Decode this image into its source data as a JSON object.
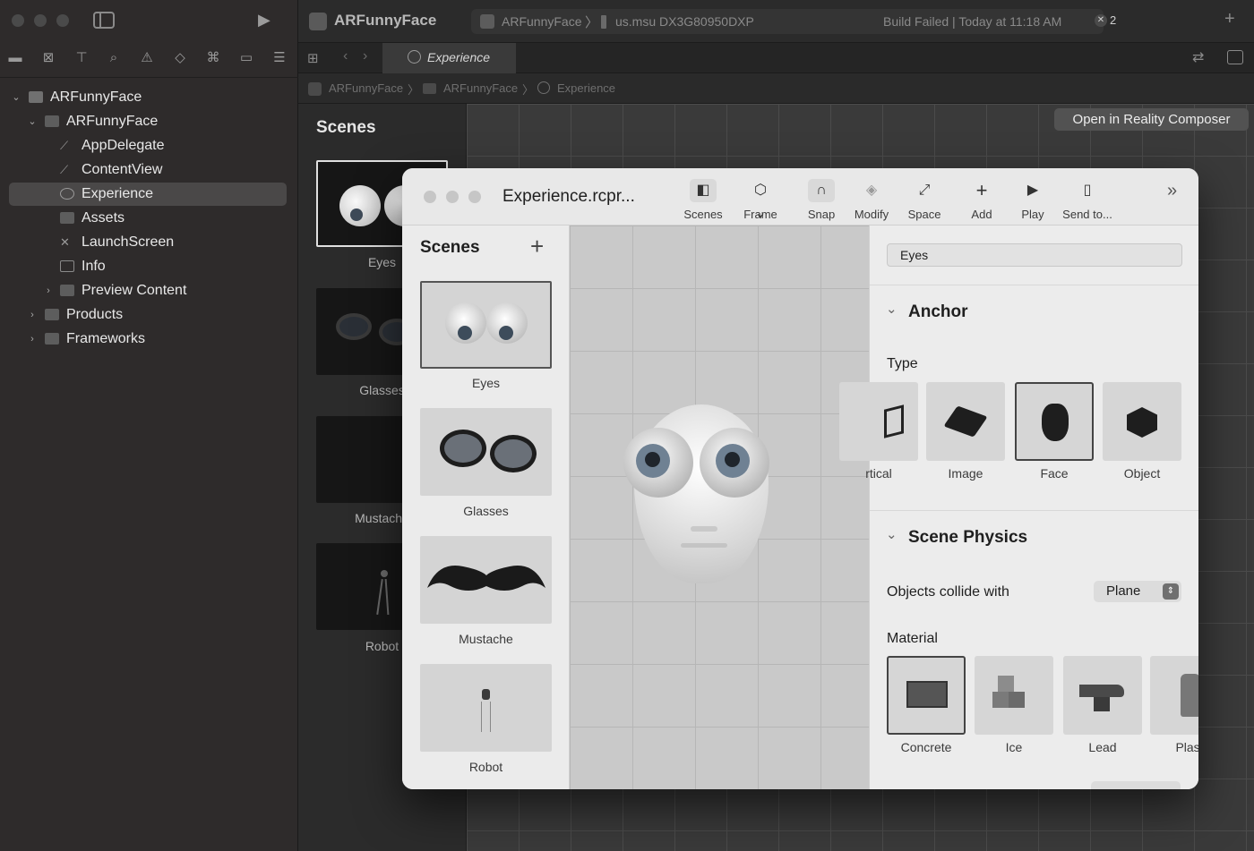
{
  "xcode": {
    "sidebar": {
      "tree": [
        {
          "label": "ARFunnyFace",
          "icon": "project-icon",
          "level": 0,
          "expanded": true
        },
        {
          "label": "ARFunnyFace",
          "icon": "folder-icon",
          "level": 1,
          "expanded": true
        },
        {
          "label": "AppDelegate",
          "icon": "swift-file-icon",
          "level": 2
        },
        {
          "label": "ContentView",
          "icon": "swift-file-icon",
          "level": 2
        },
        {
          "label": "Experience",
          "icon": "reality-file-icon",
          "level": 2,
          "selected": true
        },
        {
          "label": "Assets",
          "icon": "assets-icon",
          "level": 2
        },
        {
          "label": "LaunchScreen",
          "icon": "storyboard-icon",
          "level": 2
        },
        {
          "label": "Info",
          "icon": "plist-icon",
          "level": 2
        },
        {
          "label": "Preview Content",
          "icon": "folder-icon",
          "level": 2,
          "expanded": false
        },
        {
          "label": "Products",
          "icon": "folder-icon",
          "level": 1,
          "expanded": false
        },
        {
          "label": "Frameworks",
          "icon": "folder-icon",
          "level": 1,
          "expanded": false
        }
      ]
    },
    "toolbar": {
      "project_title": "ARFunnyFace",
      "scheme": "ARFunnyFace",
      "device": "us.msu DX3G80950DXP",
      "status": "Build Failed | Today at 11:18 AM",
      "error_count": "2"
    },
    "tab": {
      "label": "Experience"
    },
    "jumpbar": [
      "ARFunnyFace",
      "ARFunnyFace",
      "Experience"
    ],
    "open_button": "Open in Reality Composer",
    "scenes": {
      "title": "Scenes",
      "items": [
        "Eyes",
        "Glasses",
        "Mustache",
        "Robot"
      ]
    }
  },
  "rc": {
    "title": "Experience.rcpr...",
    "toolbar": [
      "Scenes",
      "Frame",
      "Snap",
      "Modify",
      "Space",
      "Add",
      "Play",
      "Send to..."
    ],
    "scenes": {
      "title": "Scenes",
      "items": [
        "Eyes",
        "Glasses",
        "Mustache",
        "Robot"
      ]
    },
    "inspector": {
      "name_value": "Eyes",
      "anchor_title": "Anchor",
      "type_label": "Type",
      "types": [
        "rtical",
        "Image",
        "Face",
        "Object"
      ],
      "selected_type": "Face",
      "physics_title": "Scene Physics",
      "collide_label": "Objects collide with",
      "collide_value": "Plane",
      "material_label": "Material",
      "materials": [
        "Concrete",
        "Ice",
        "Lead",
        "Plast"
      ],
      "selected_material": "Concrete"
    }
  }
}
